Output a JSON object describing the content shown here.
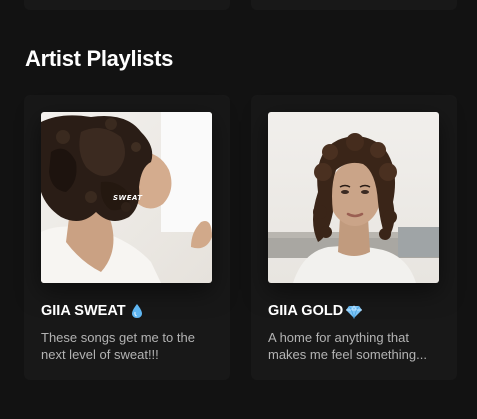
{
  "section": {
    "title": "Artist Playlists"
  },
  "playlists": [
    {
      "title": "GIIA SWEAT",
      "icon": "droplet-icon",
      "cover_text": "SWEAT",
      "description": "These songs get me to the next level of sweat!!!"
    },
    {
      "title": "GIIA GOLD",
      "icon": "diamond-icon",
      "description": "A home for anything that makes me feel something..."
    }
  ],
  "colors": {
    "background": "#121212",
    "card": "#181818",
    "title": "#ffffff",
    "subtext": "#b3b3b3"
  }
}
